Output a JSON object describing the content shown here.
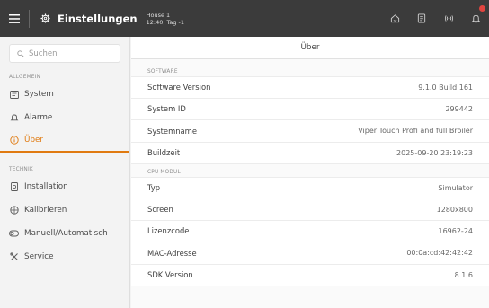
{
  "header": {
    "title": "Einstellungen",
    "house_name": "House 1",
    "house_time": "12:40, Tag -1"
  },
  "sidebar": {
    "search_placeholder": "Suchen",
    "sections": [
      {
        "label": "ALLGEMEIN",
        "items": [
          {
            "label": "System",
            "icon": "system-icon",
            "active": false
          },
          {
            "label": "Alarme",
            "icon": "bell-icon",
            "active": false
          },
          {
            "label": "Über",
            "icon": "info-icon",
            "active": true
          }
        ]
      },
      {
        "label": "TECHNIK",
        "items": [
          {
            "label": "Installation",
            "icon": "installation-icon",
            "active": false
          },
          {
            "label": "Kalibrieren",
            "icon": "calibrate-icon",
            "active": false
          },
          {
            "label": "Manuell/Automatisch",
            "icon": "toggle-icon",
            "active": false
          },
          {
            "label": "Service",
            "icon": "tools-icon",
            "active": false
          }
        ]
      }
    ]
  },
  "main": {
    "title": "Über",
    "groups": [
      {
        "label": "SOFTWARE",
        "rows": [
          {
            "key": "Software Version",
            "value": "9.1.0 Build 161"
          },
          {
            "key": "System ID",
            "value": "299442"
          },
          {
            "key": "Systemname",
            "value": "Viper Touch Profi and full Broiler"
          },
          {
            "key": "Buildzeit",
            "value": "2025-09-20 23:19:23"
          }
        ]
      },
      {
        "label": "CPU MODUL",
        "rows": [
          {
            "key": "Typ",
            "value": "Simulator"
          },
          {
            "key": "Screen",
            "value": "1280x800"
          },
          {
            "key": "Lizenzcode",
            "value": "16962-24"
          },
          {
            "key": "MAC-Adresse",
            "value": "00:0a:cd:42:42:42"
          },
          {
            "key": "SDK Version",
            "value": "8.1.6"
          }
        ]
      }
    ]
  },
  "colors": {
    "header_bg": "#3b3b3b",
    "accent": "#e07a10",
    "badge": "#e0443f"
  }
}
